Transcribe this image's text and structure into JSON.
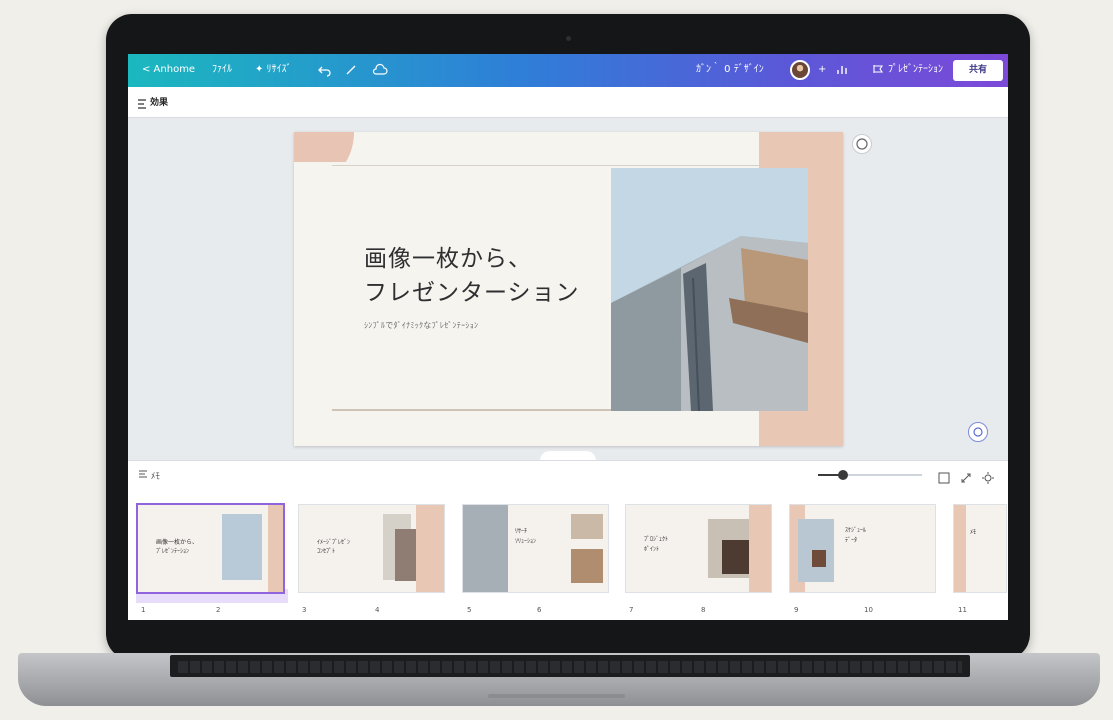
{
  "topbar": {
    "back_label": "< Anhome",
    "file_label": "ﾌｧｲﾙ",
    "resize_label": "✦ ﾘｻｲｽﾞ",
    "status_text": "ｶﾞﾝ｀ 0 ﾃﾞｻﾞｲﾝ",
    "present_label": "ﾌﾟﾚｾﾞﾝﾃｰｼｮﾝ",
    "share_label": "共有"
  },
  "toolbar2": {
    "label": "効果"
  },
  "slide": {
    "title_line1": "画像一枚から、",
    "title_line2": "フレゼンターション",
    "subtitle": "ｼﾝﾌﾟﾙでﾀﾞｲﾅﾐｯｸなﾌﾟﾚｾﾞﾝﾃｰｼｮﾝ"
  },
  "bottom": {
    "label": "ﾒﾓ",
    "zoom_fraction": 0.24
  },
  "thumbnails": [
    {
      "num_left": "1",
      "num_right": "2",
      "title": "画像一枚から、",
      "sub": "ﾌﾟﾚｾﾞﾝﾃｰｼｮﾝ"
    },
    {
      "num_left": "3",
      "num_right": "4",
      "title": "ｲﾒｰｼﾞﾌﾟﾚｾﾞﾝ",
      "sub": "ｺﾝｾﾌﾟﾄ"
    },
    {
      "num_left": "5",
      "num_right": "6",
      "title": "ﾘｻｰﾁ",
      "sub": "ｿﾘｭｰｼｮﾝ"
    },
    {
      "num_left": "7",
      "num_right": "8",
      "title": "ﾌﾟﾛｼﾞｪｸﾄ",
      "sub": "ﾎﾟｲﾝﾄ"
    },
    {
      "num_left": "9",
      "num_right": "10",
      "title": "ｽｹｼﾞｭｰﾙ",
      "sub": "ﾃﾞｰﾀ"
    },
    {
      "num_left": "11",
      "num_right": "",
      "title": "ﾒﾓ",
      "sub": ""
    }
  ],
  "icons": {
    "undo": "undo-icon",
    "redo": "redo-icon",
    "cloud": "cloud-icon",
    "grid": "grid-icon",
    "fullscreen": "fullscreen-icon",
    "settings": "settings-icon",
    "chevron-up": "chevron-up-icon"
  },
  "colors": {
    "topbar_start": "#1bb8bf",
    "topbar_end": "#7c49d8",
    "peach": "#e9c7b5",
    "selected": "#8f64dd"
  }
}
